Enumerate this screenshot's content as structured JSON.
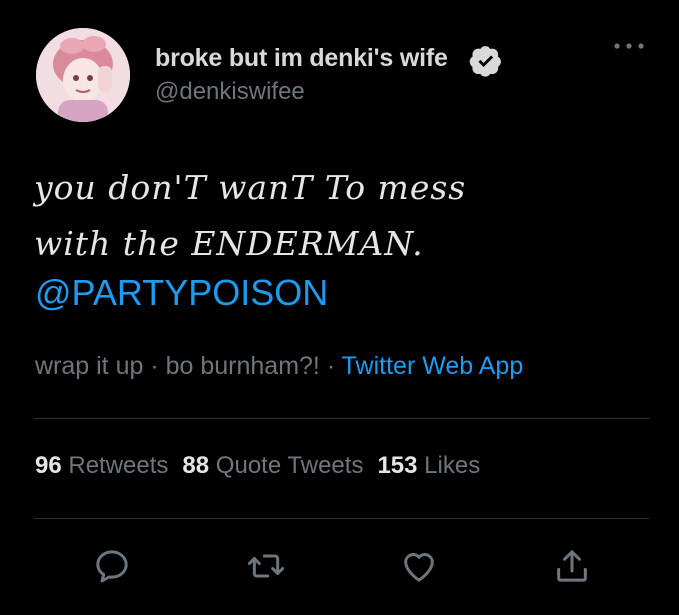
{
  "author": {
    "display_name": "broke but im denki's wife",
    "handle": "@denkiswifee",
    "verified": true,
    "avatar_icon": "avatar-image"
  },
  "tweet": {
    "text_lines": [
      "you don'T wanT To mess",
      "with the ENDERMAN."
    ],
    "mention": "@PARTYPOISON"
  },
  "meta": {
    "caption": "wrap it up · bo burnham?!",
    "separator": " · ",
    "source": "Twitter Web App"
  },
  "stats": {
    "retweets_count": "96",
    "retweets_label": "Retweets",
    "quotes_count": "88",
    "quotes_label": "Quote Tweets",
    "likes_count": "153",
    "likes_label": "Likes"
  },
  "actions": [
    "reply-icon",
    "retweet-icon",
    "like-icon",
    "share-icon"
  ],
  "more_icon": "more-icon",
  "colors": {
    "background": "#000000",
    "primary_text": "#d9d9d9",
    "secondary_text": "#6e767d",
    "link": "#1d9bf0",
    "divider": "#2f3336"
  }
}
